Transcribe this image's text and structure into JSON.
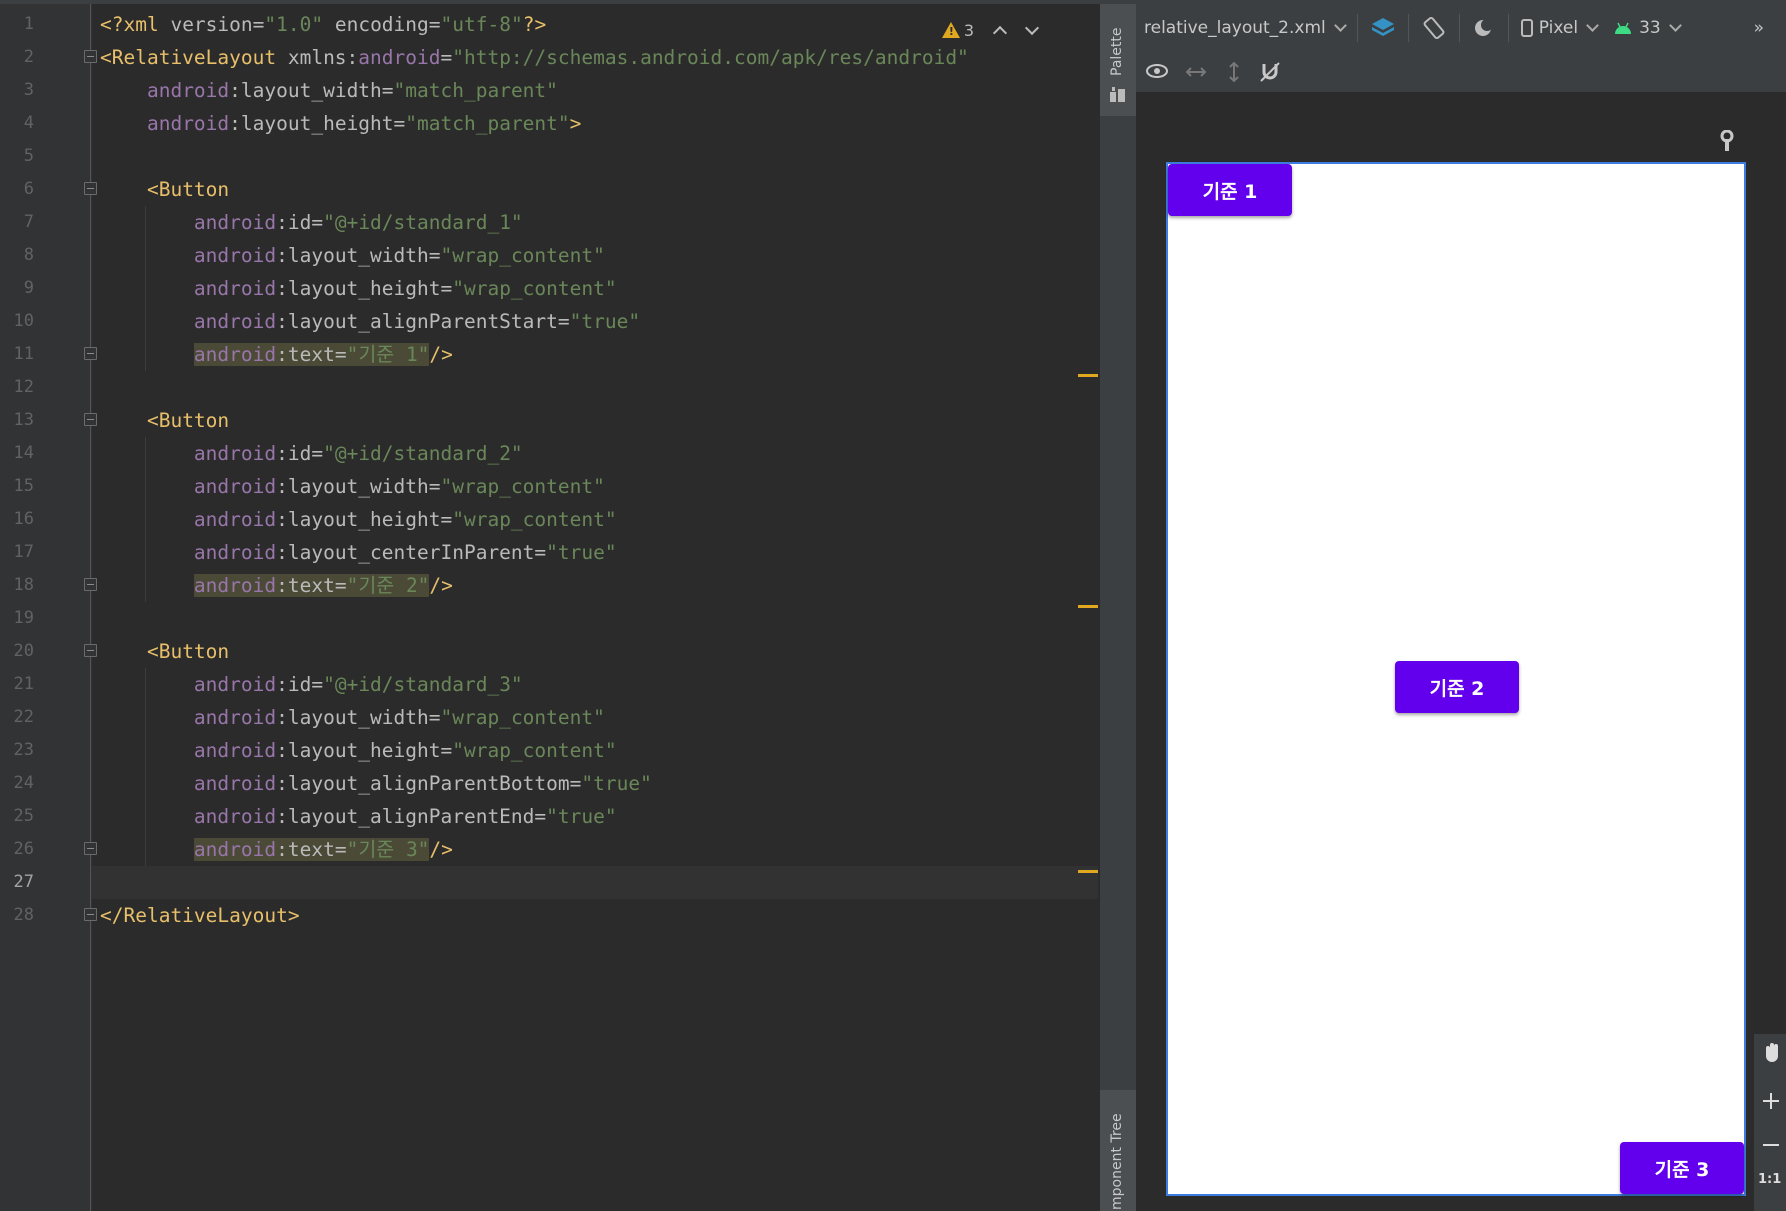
{
  "editor": {
    "line_numbers": [
      "1",
      "2",
      "3",
      "4",
      "5",
      "6",
      "7",
      "8",
      "9",
      "10",
      "11",
      "12",
      "13",
      "14",
      "15",
      "16",
      "17",
      "18",
      "19",
      "20",
      "21",
      "22",
      "23",
      "24",
      "25",
      "26",
      "27",
      "28"
    ],
    "warning_count": "3",
    "code": {
      "l1_open": "<?xml ",
      "l1_version_attr": "version",
      "l1_version_val": "\"1.0\"",
      "l1_encoding_attr": "encoding",
      "l1_encoding_val": "\"utf-8\"",
      "l1_close": "?>",
      "l2_tag": "<RelativeLayout ",
      "l2_attr": "xmlns:",
      "l2_ns": "android",
      "l2_val": "\"http://schemas.android.com/apk/res/android\"",
      "ns": "android",
      "layout_width": "layout_width",
      "layout_height": "layout_height",
      "match_parent": "\"match_parent\"",
      "match_parent_close": "\"match_parent\"",
      "gt": ">",
      "button_tag": "<Button",
      "id_attr": "id",
      "id_val_1": "\"@+id/standard_1\"",
      "id_val_2": "\"@+id/standard_2\"",
      "id_val_3": "\"@+id/standard_3\"",
      "wrap_content": "\"wrap_content\"",
      "align_parent_start": "layout_alignParentStart",
      "center_in_parent": "layout_centerInParent",
      "align_parent_bottom": "layout_alignParentBottom",
      "align_parent_end": "layout_alignParentEnd",
      "true_val": "\"true\"",
      "text_attr": "text",
      "text_val_1": "\"기준 1\"",
      "text_val_2": "\"기준 2\"",
      "text_val_3": "\"기준 3\"",
      "self_close": "/>",
      "close_tag": "</RelativeLayout>"
    }
  },
  "side_strip": {
    "palette_label": "Palette",
    "component_tree_label": "mponent Tree"
  },
  "design_toolbar": {
    "file_name": "relative_layout_2.xml",
    "device": "Pixel",
    "api_level": "33",
    "overflow": "»"
  },
  "preview": {
    "button_1": "기준 1",
    "button_2": "기준 2",
    "button_3": "기준 3",
    "zoom_label": "1:1"
  },
  "colors": {
    "button_bg": "#6200ee",
    "editor_bg": "#2b2b2b",
    "tag": "#e8bf6a",
    "namespace": "#9876aa",
    "string": "#6a8759",
    "warning": "#e0a821"
  }
}
